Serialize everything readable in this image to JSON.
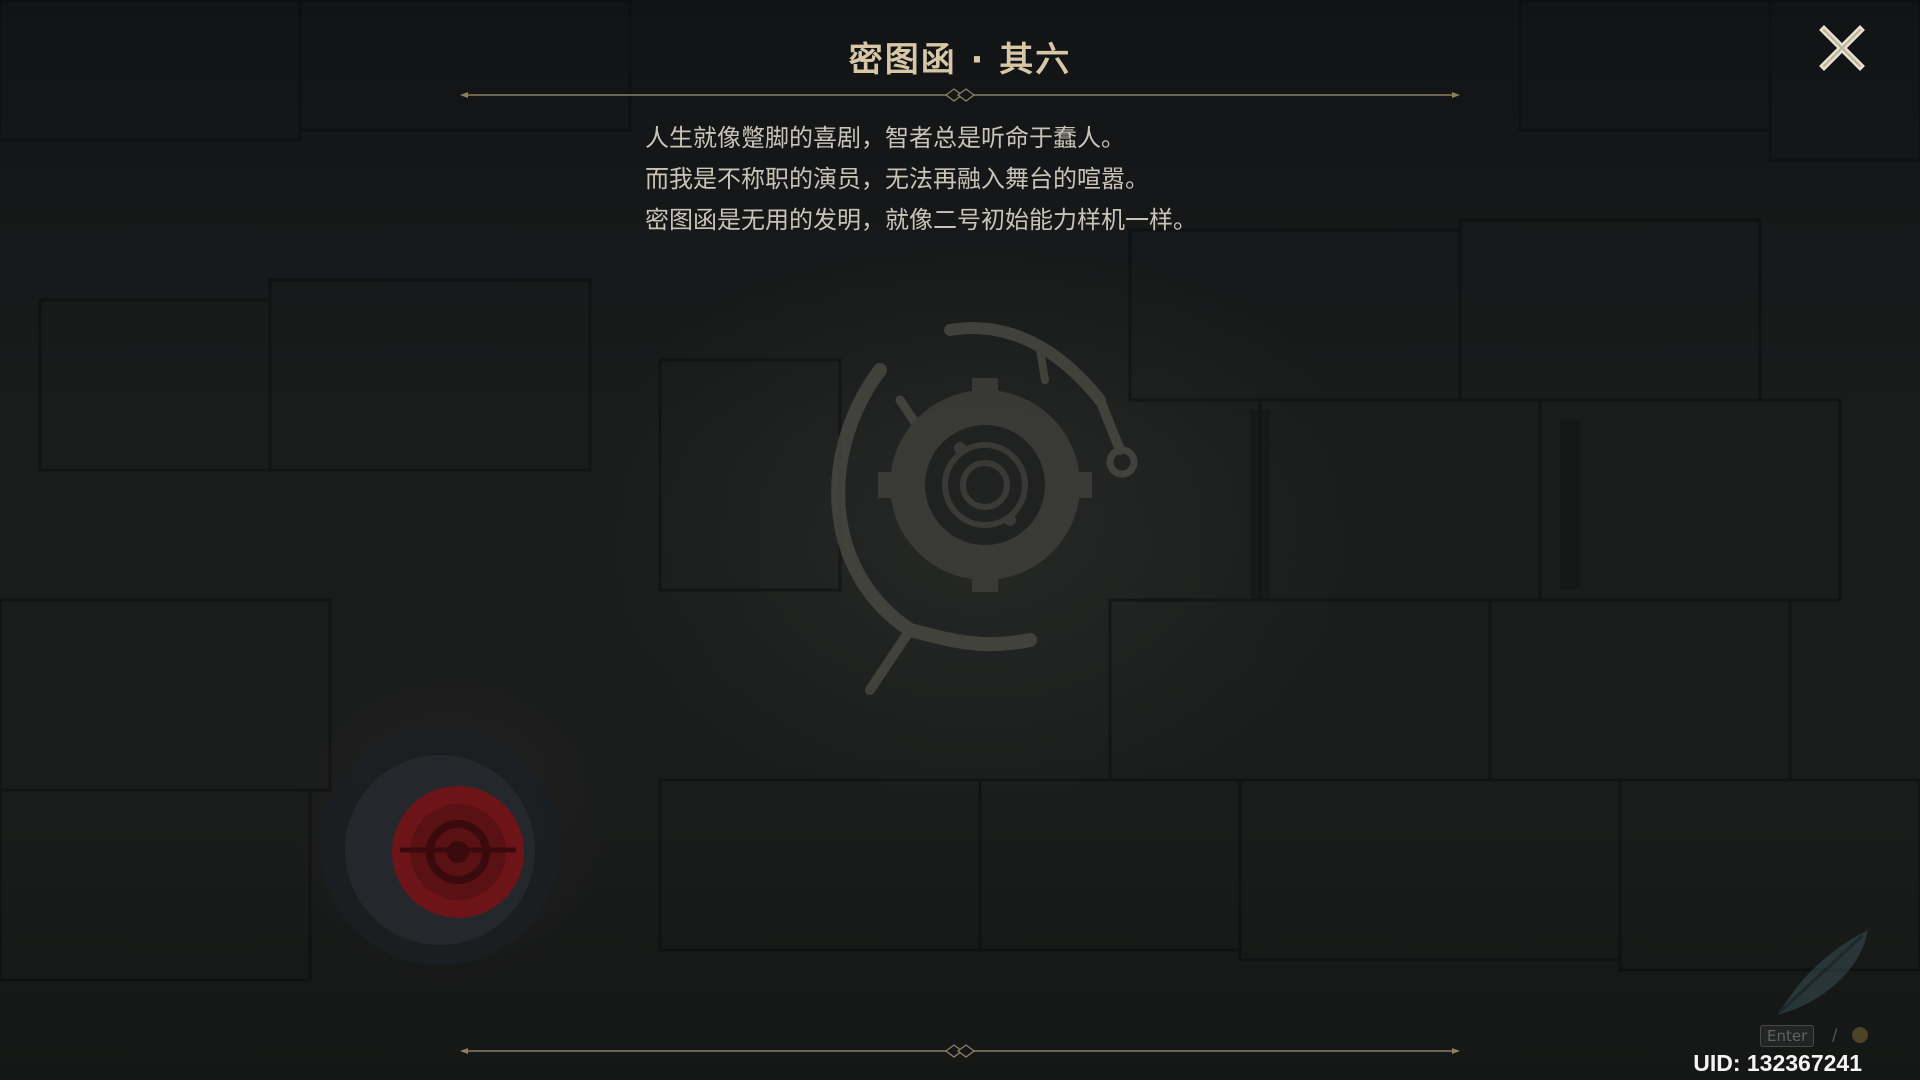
{
  "dialog": {
    "title": "密图函 · 其六",
    "lines": [
      "人生就像蹩脚的喜剧，智者总是听命于蠢人。",
      "而我是不称职的演员，无法再融入舞台的喧嚣。",
      "密图函是无用的发明，就像二号初始能力样机一样。"
    ]
  },
  "controls": {
    "close_icon": "close-icon",
    "enter_key_label": "Enter",
    "separator": "/"
  },
  "footer": {
    "uid": "UID: 132367241"
  },
  "colors": {
    "title": "#d8c7a6",
    "text": "#c9c3b8",
    "divider": "#8c7f66",
    "background": "#141618",
    "red_button": "#8a1a1c"
  }
}
